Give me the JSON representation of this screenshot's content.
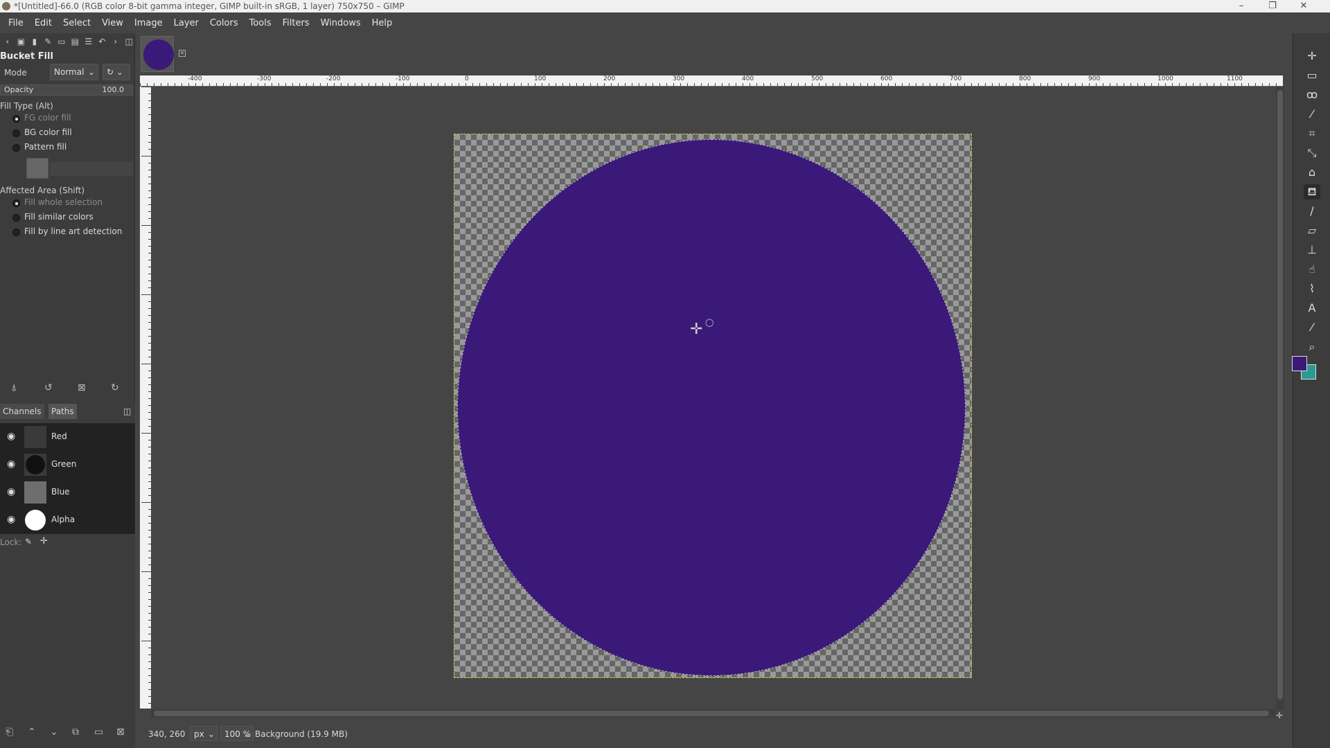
{
  "window": {
    "title": "*[Untitled]-66.0 (RGB color 8-bit gamma integer, GIMP built-in sRGB, 1 layer) 750x750 – GIMP",
    "minimize": "–",
    "restore": "❐",
    "close": "✕"
  },
  "menu": [
    "File",
    "Edit",
    "Select",
    "View",
    "Image",
    "Layer",
    "Colors",
    "Tools",
    "Filters",
    "Windows",
    "Help"
  ],
  "tool_options": {
    "title": "Bucket Fill",
    "mode_label": "Mode",
    "mode_value": "Normal",
    "opacity_label": "Opacity",
    "opacity_value": "100.0",
    "fill_type_label": "Fill Type  (Alt)",
    "fill_types": [
      "FG color fill",
      "BG color fill",
      "Pattern fill"
    ],
    "fill_type_selected": "FG color fill",
    "affected_area_label": "Affected Area  (Shift)",
    "affected_areas": [
      "Fill whole selection",
      "Fill similar colors",
      "Fill by line art detection"
    ],
    "affected_area_selected": "Fill whole selection"
  },
  "channels_panel": {
    "tab_channels": "Channels",
    "tab_paths": "Paths",
    "channels": [
      {
        "name": "Red"
      },
      {
        "name": "Green"
      },
      {
        "name": "Blue"
      },
      {
        "name": "Alpha"
      }
    ],
    "lock_label": "Lock:"
  },
  "rulers": {
    "horizontal": [
      "-400",
      "-300",
      "-200",
      "-100",
      "0",
      "100",
      "200",
      "300",
      "400",
      "500",
      "600",
      "700",
      "800",
      "900",
      "1000",
      "1100"
    ]
  },
  "status": {
    "coords": "340, 260",
    "unit": "px",
    "zoom": "100 %",
    "layer_info": "Background (19.9 MB)"
  },
  "colors": {
    "foreground": "#3a1978",
    "background": "#2a9a92"
  },
  "toolbox_icons": [
    "move-icon",
    "rect-select-icon",
    "lasso-icon",
    "fuzzy-select-icon",
    "crop-icon",
    "transform-icon",
    "warp-icon",
    "bucket-fill-icon",
    "paintbrush-icon",
    "eraser-icon",
    "clone-icon",
    "smudge-icon",
    "paths-icon",
    "text-icon",
    "color-picker-icon",
    "zoom-icon"
  ]
}
